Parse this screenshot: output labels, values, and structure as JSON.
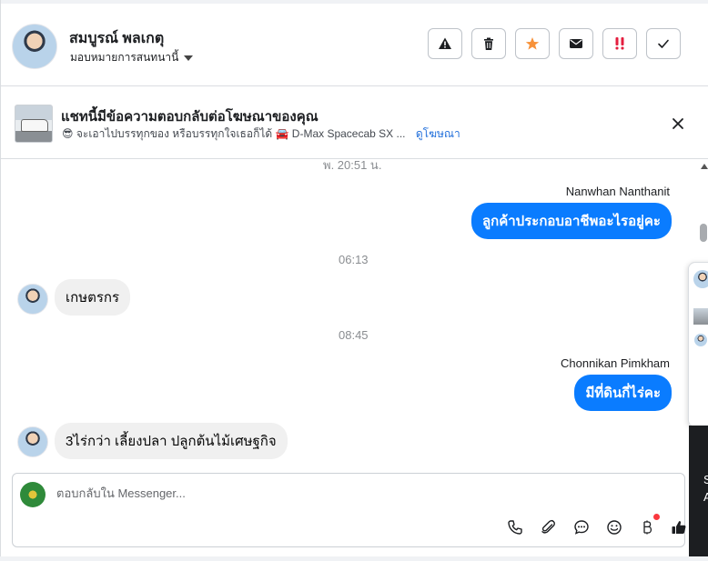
{
  "header": {
    "contact_name": "สมบูรณ์ พลเกตุ",
    "assign_label": "มอบหมายการสนทนานี้",
    "tools": [
      {
        "icon": "warning-icon"
      },
      {
        "icon": "trash-icon"
      },
      {
        "icon": "star-icon",
        "color": "#f7923a"
      },
      {
        "icon": "mail-icon"
      },
      {
        "icon": "important-icon",
        "color": "#e41e3f"
      },
      {
        "icon": "check-icon"
      }
    ]
  },
  "ad_banner": {
    "title": "แชทนี้มีข้อความตอบกลับต่อโฆษณาของคุณ",
    "subtitle": "😎 จะเอาไปบรรทุกของ หรือบรรทุกใจเธอก็ได้ 🚘 D-Max Spacecab SX ...",
    "link_label": "ดูโฆษณา"
  },
  "conversation": [
    {
      "type": "timestamp",
      "text": "พ. 20:51 น."
    },
    {
      "type": "sender",
      "text": "Nanwhan Nanthanit"
    },
    {
      "type": "outgoing",
      "text": "ลูกค้าประกอบอาชีพอะไรอยู่คะ"
    },
    {
      "type": "timestamp",
      "text": "06:13"
    },
    {
      "type": "incoming",
      "text": "เกษตรกร"
    },
    {
      "type": "timestamp",
      "text": "08:45"
    },
    {
      "type": "sender",
      "text": "Chonnikan Pimkham"
    },
    {
      "type": "outgoing",
      "text": "มีที่ดินกี่ไร่คะ"
    },
    {
      "type": "incoming",
      "text": "3ไร่กว่า เลี้ยงปลา ปลูกต้นไม้เศษฐกิจ"
    }
  ],
  "side_panel": {
    "lines": [
      "S",
      "A"
    ]
  },
  "composer": {
    "placeholder": "ตอบกลับใน Messenger...",
    "actions": [
      "phone-icon",
      "attachment-icon",
      "saved-replies-icon",
      "emoji-icon",
      "payment-icon",
      "like-icon"
    ]
  },
  "colors": {
    "accent": "#0a7cff",
    "link": "#216fdb",
    "notification": "#fa383e"
  }
}
